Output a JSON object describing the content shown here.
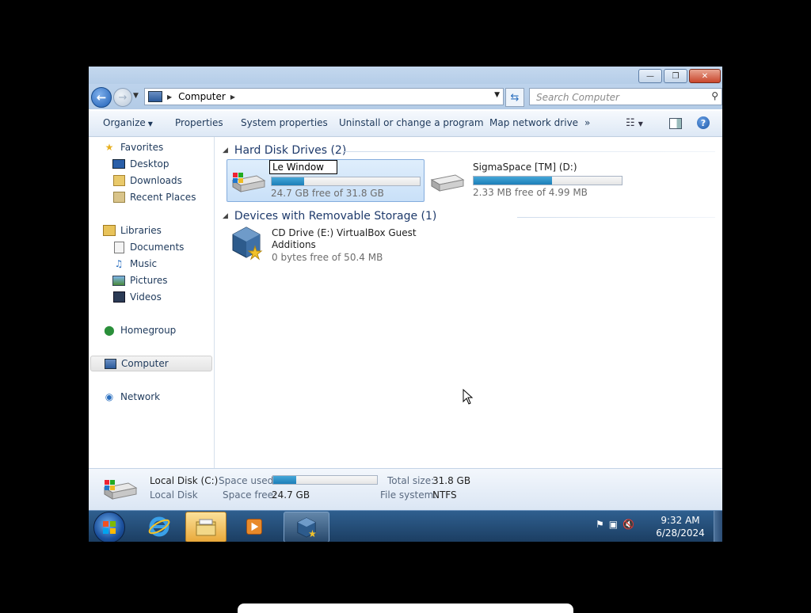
{
  "window": {
    "controls": {
      "minimize": "—",
      "maximize": "❐",
      "close": "✕"
    }
  },
  "address": {
    "path": "Computer",
    "search_placeholder": "Search Computer"
  },
  "toolbar": {
    "organize": "Organize",
    "properties": "Properties",
    "system_properties": "System properties",
    "uninstall": "Uninstall or change a program",
    "map_drive": "Map network drive",
    "more": "»"
  },
  "sidebar": {
    "favorites": "Favorites",
    "desktop": "Desktop",
    "downloads": "Downloads",
    "recent": "Recent Places",
    "libraries": "Libraries",
    "documents": "Documents",
    "music": "Music",
    "pictures": "Pictures",
    "videos": "Videos",
    "homegroup": "Homegroup",
    "computer": "Computer",
    "network": "Network"
  },
  "groups": {
    "hdd": "Hard Disk Drives (2)",
    "removable": "Devices with Removable Storage (1)"
  },
  "drives": {
    "c": {
      "rename_text": "Le Window",
      "free": "24.7 GB free of 31.8 GB",
      "used_fraction": 0.22
    },
    "d": {
      "name": "SigmaSpace [TM] (D:)",
      "free": "2.33 MB free of 4.99 MB",
      "used_fraction": 0.53
    },
    "e": {
      "name_line1": "CD Drive (E:) VirtualBox Guest",
      "name_line2": "Additions",
      "free": "0 bytes free of 50.4 MB"
    }
  },
  "details": {
    "name": "Local Disk (C:)",
    "type": "Local Disk",
    "space_used_label": "Space used:",
    "space_free_label": "Space free:",
    "space_free": "24.7 GB",
    "total_size_label": "Total size:",
    "total_size": "31.8 GB",
    "filesystem_label": "File system:",
    "filesystem": "NTFS",
    "used_fraction": 0.22
  },
  "taskbar": {
    "time": "9:32 AM",
    "date": "6/28/2024"
  },
  "colors": {
    "accent": "#1e395b",
    "selection": "#c9e0f8",
    "bar_fill": "#2a8fc6"
  }
}
